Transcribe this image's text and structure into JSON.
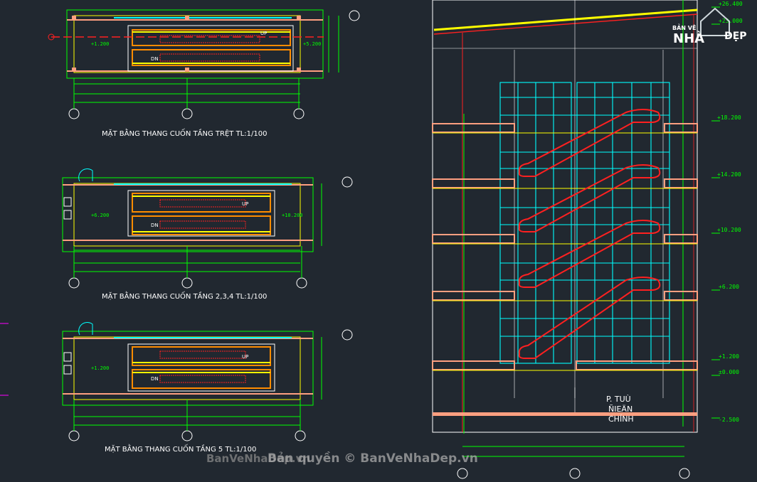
{
  "titles": {
    "plan_ground": "MẶT BẰNG THANG CUỐN TẦNG TRỆT TL:1/100",
    "plan_234": "MẶT BẰNG THANG CUỐN TẦNG 2,3,4 TL:1/100",
    "plan_5": "MẶT BẰNG THANG CUỐN TẦNG 5 TL:1/100"
  },
  "labels": {
    "up": "UP",
    "dn": "DN",
    "room_line1": "P. TUÙ",
    "room_line2": "ÑIEÄN",
    "room_line3": "CHÍNH"
  },
  "plan_levels": {
    "ground_left": "+1.200",
    "ground_right": "+5.200",
    "f234_left": "+6.200",
    "f234_right": "+10.200",
    "f5_left": "+1.200"
  },
  "section_levels": [
    "+26.400",
    "+23.000",
    "+18.200",
    "+14.200",
    "+10.200",
    "+6.200",
    "+1.200",
    "±0.000",
    "-2.500"
  ],
  "watermarks": {
    "logo_top": "BẢN VẼ",
    "logo_mid": "NHÀ",
    "logo_end": "ĐẸP",
    "footer_1": "BanVeNhaDep.vn",
    "footer_2": "Bản quyền © BanVeNhaDep.vn"
  },
  "colors": {
    "background": "#212830",
    "green": "#00ff00",
    "yellow": "#ffff00",
    "red": "#ff2020",
    "magenta": "#ff00ff",
    "cyan": "#00ffff",
    "salmon": "#ff9f80",
    "orange": "#ff8c00",
    "white": "#ffffff"
  }
}
